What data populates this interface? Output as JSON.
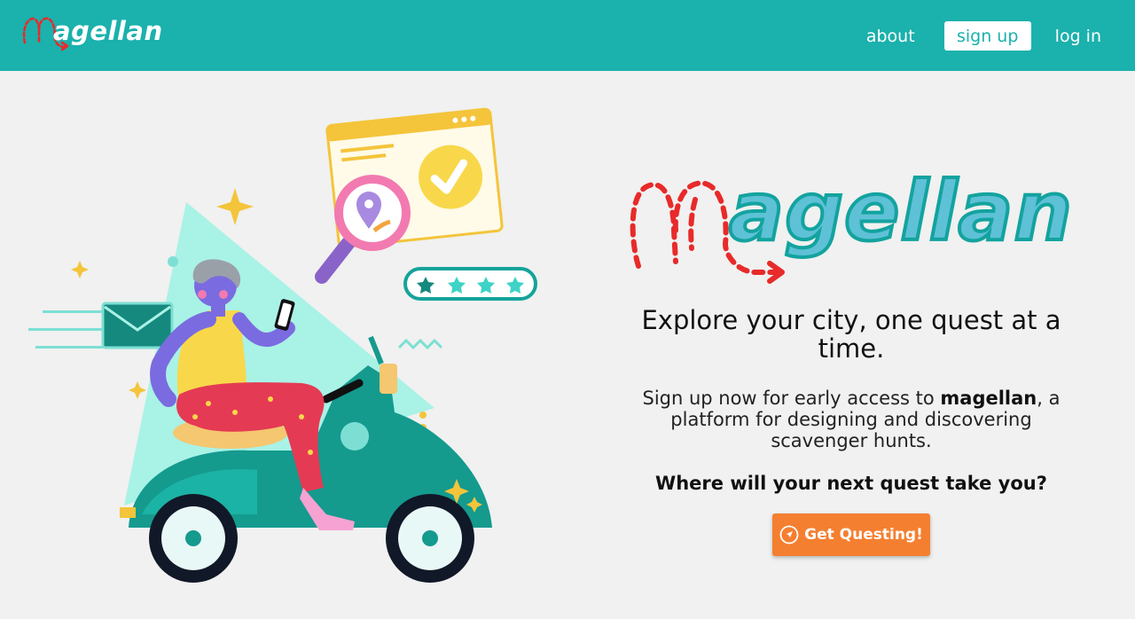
{
  "nav": {
    "brand_text": "agellan",
    "about": "about",
    "sign_up": "sign up",
    "log_in": "log in"
  },
  "hero": {
    "logo_text": "agellan",
    "tagline": "Explore your city, one quest at a time.",
    "description_before": "Sign up now for early access to ",
    "description_brand": "magellan",
    "description_after": ", a platform for designing and discovering scavenger hunts.",
    "question": "Where will your next quest take you?",
    "cta_label": "Get Questing!",
    "cta_icon": "compass-icon"
  },
  "colors": {
    "primary": "#1bb1ac",
    "accent": "#f47f30",
    "logo_fill": "#5ec1d6",
    "logo_dash": "#e82a2a",
    "background": "#f0f1f0"
  }
}
